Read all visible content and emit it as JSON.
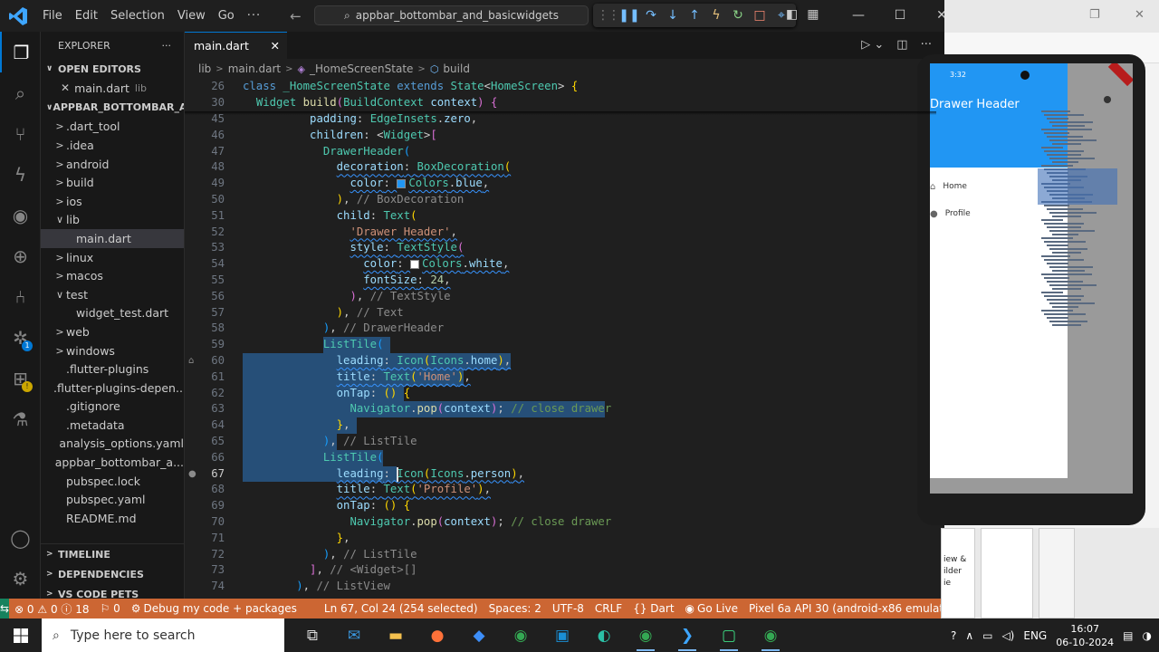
{
  "window": {
    "menu": [
      "File",
      "Edit",
      "Selection",
      "View",
      "Go",
      "···"
    ],
    "command_center": "appbar_bottombar_and_basicwidgets",
    "colors": {
      "accent": "#0078d4",
      "statusbar": "#cc6633",
      "remote": "#16825d",
      "selection": "#264f78"
    }
  },
  "sidebar": {
    "title": "EXPLORER",
    "open_editors_title": "OPEN EDITORS",
    "open_editor": {
      "name": "main.dart",
      "path": "lib"
    },
    "project_title": "APPBAR_BOTTOMBAR_AN...",
    "tree": [
      {
        "label": ".dart_tool",
        "folder": true,
        "open": false,
        "depth": 0
      },
      {
        "label": ".idea",
        "folder": true,
        "open": false,
        "depth": 0
      },
      {
        "label": "android",
        "folder": true,
        "open": false,
        "depth": 0
      },
      {
        "label": "build",
        "folder": true,
        "open": false,
        "depth": 0
      },
      {
        "label": "ios",
        "folder": true,
        "open": false,
        "depth": 0
      },
      {
        "label": "lib",
        "folder": true,
        "open": true,
        "depth": 0
      },
      {
        "label": "main.dart",
        "folder": false,
        "depth": 1,
        "selected": true
      },
      {
        "label": "linux",
        "folder": true,
        "open": false,
        "depth": 0
      },
      {
        "label": "macos",
        "folder": true,
        "open": false,
        "depth": 0
      },
      {
        "label": "test",
        "folder": true,
        "open": true,
        "depth": 0
      },
      {
        "label": "widget_test.dart",
        "folder": false,
        "depth": 1
      },
      {
        "label": "web",
        "folder": true,
        "open": false,
        "depth": 0
      },
      {
        "label": "windows",
        "folder": true,
        "open": false,
        "depth": 0
      },
      {
        "label": ".flutter-plugins",
        "folder": false,
        "depth": 0
      },
      {
        "label": ".flutter-plugins-depen...",
        "folder": false,
        "depth": 0
      },
      {
        "label": ".gitignore",
        "folder": false,
        "depth": 0
      },
      {
        "label": ".metadata",
        "folder": false,
        "depth": 0
      },
      {
        "label": "analysis_options.yaml",
        "folder": false,
        "depth": 0
      },
      {
        "label": "appbar_bottombar_a...",
        "folder": false,
        "depth": 0
      },
      {
        "label": "pubspec.lock",
        "folder": false,
        "depth": 0
      },
      {
        "label": "pubspec.yaml",
        "folder": false,
        "depth": 0
      },
      {
        "label": "README.md",
        "folder": false,
        "depth": 0
      }
    ],
    "bottom_sections": [
      "TIMELINE",
      "DEPENDENCIES",
      "VS CODE PETS"
    ]
  },
  "editor": {
    "tab": "main.dart",
    "breadcrumb": [
      "lib",
      "main.dart",
      "_HomeScreenState",
      "build"
    ],
    "sticky_lines": [
      {
        "num": "26",
        "tokens": [
          [
            "class ",
            "kw"
          ],
          [
            "_HomeScreenState ",
            "cls"
          ],
          [
            "extends ",
            "kw"
          ],
          [
            "State",
            "cls"
          ],
          [
            "<",
            ""
          ],
          [
            "HomeScreen",
            "cls"
          ],
          [
            "> ",
            ""
          ],
          [
            "{",
            "br1"
          ]
        ]
      },
      {
        "num": "30",
        "tokens": [
          [
            "  ",
            ""
          ],
          [
            "Widget ",
            "cls"
          ],
          [
            "build",
            "fn"
          ],
          [
            "(",
            "br2"
          ],
          [
            "BuildContext ",
            "cls"
          ],
          [
            "context",
            "prm"
          ],
          [
            ") ",
            "br2"
          ],
          [
            "{",
            "br2"
          ]
        ]
      }
    ],
    "lines": [
      {
        "num": "45",
        "tokens": [
          [
            "          ",
            ""
          ],
          [
            "padding",
            "prm"
          ],
          [
            ": ",
            ""
          ],
          [
            "EdgeInsets",
            "cls"
          ],
          [
            ".",
            ""
          ],
          [
            "zero",
            "prm"
          ],
          [
            ",",
            ""
          ]
        ]
      },
      {
        "num": "46",
        "tokens": [
          [
            "          ",
            ""
          ],
          [
            "children",
            "prm"
          ],
          [
            ": <",
            ""
          ],
          [
            "Widget",
            "cls"
          ],
          [
            ">",
            ""
          ],
          [
            "[",
            "br2"
          ]
        ]
      },
      {
        "num": "47",
        "tokens": [
          [
            "            ",
            ""
          ],
          [
            "DrawerHeader",
            "cls"
          ],
          [
            "(",
            "br3"
          ]
        ]
      },
      {
        "num": "48",
        "tokens": [
          [
            "              ",
            ""
          ],
          [
            "decoration",
            "prm"
          ],
          [
            ": ",
            ""
          ],
          [
            "BoxDecoration",
            "cls"
          ],
          [
            "(",
            "br1"
          ]
        ]
      },
      {
        "num": "49",
        "tokens": [
          [
            "                ",
            ""
          ],
          [
            "color",
            "prm"
          ],
          [
            ": ",
            ""
          ],
          [
            "■",
            "swatch-blue"
          ],
          [
            "Colors",
            "cls"
          ],
          [
            ".",
            ""
          ],
          [
            "blue",
            "prm"
          ],
          [
            ",",
            ""
          ]
        ]
      },
      {
        "num": "50",
        "tokens": [
          [
            "              ",
            ""
          ],
          [
            ")",
            "br1"
          ],
          [
            ", ",
            ""
          ],
          [
            "// BoxDecoration",
            "gray"
          ]
        ]
      },
      {
        "num": "51",
        "tokens": [
          [
            "              ",
            ""
          ],
          [
            "child",
            "prm"
          ],
          [
            ": ",
            ""
          ],
          [
            "Text",
            "cls"
          ],
          [
            "(",
            "br1"
          ]
        ]
      },
      {
        "num": "52",
        "tokens": [
          [
            "                ",
            ""
          ],
          [
            "'Drawer Header'",
            "str"
          ],
          [
            ",",
            ""
          ]
        ]
      },
      {
        "num": "53",
        "tokens": [
          [
            "                ",
            ""
          ],
          [
            "style",
            "prm"
          ],
          [
            ": ",
            ""
          ],
          [
            "TextStyle",
            "cls"
          ],
          [
            "(",
            "br2"
          ]
        ]
      },
      {
        "num": "54",
        "tokens": [
          [
            "                  ",
            ""
          ],
          [
            "color",
            "prm"
          ],
          [
            ": ",
            ""
          ],
          [
            "■",
            "swatch-white"
          ],
          [
            "Colors",
            "cls"
          ],
          [
            ".",
            ""
          ],
          [
            "white",
            "prm"
          ],
          [
            ",",
            ""
          ]
        ]
      },
      {
        "num": "55",
        "tokens": [
          [
            "                  ",
            ""
          ],
          [
            "fontSize",
            "prm"
          ],
          [
            ": ",
            ""
          ],
          [
            "24",
            "num"
          ],
          [
            ",",
            ""
          ]
        ]
      },
      {
        "num": "56",
        "tokens": [
          [
            "                ",
            ""
          ],
          [
            ")",
            "br2"
          ],
          [
            ", ",
            ""
          ],
          [
            "// TextStyle",
            "gray"
          ]
        ]
      },
      {
        "num": "57",
        "tokens": [
          [
            "              ",
            ""
          ],
          [
            ")",
            "br1"
          ],
          [
            ", ",
            ""
          ],
          [
            "// Text",
            "gray"
          ]
        ]
      },
      {
        "num": "58",
        "tokens": [
          [
            "            ",
            ""
          ],
          [
            ")",
            "br3"
          ],
          [
            ", ",
            ""
          ],
          [
            "// DrawerHeader",
            "gray"
          ]
        ]
      },
      {
        "num": "59",
        "tokens": [
          [
            "            ",
            ""
          ],
          [
            "ListTile",
            "cls"
          ],
          [
            "(",
            "br3"
          ]
        ]
      },
      {
        "num": "60",
        "tokens": [
          [
            "              ",
            ""
          ],
          [
            "leading",
            "prm"
          ],
          [
            ": ",
            ""
          ],
          [
            "Icon",
            "cls"
          ],
          [
            "(",
            "br1"
          ],
          [
            "Icons",
            "cls"
          ],
          [
            ".",
            ""
          ],
          [
            "home",
            "prm"
          ],
          [
            ")",
            "br1"
          ],
          [
            ",",
            ""
          ]
        ]
      },
      {
        "num": "61",
        "tokens": [
          [
            "              ",
            ""
          ],
          [
            "title",
            "prm"
          ],
          [
            ": ",
            ""
          ],
          [
            "Text",
            "cls"
          ],
          [
            "(",
            "br1"
          ],
          [
            "'Home'",
            "str"
          ],
          [
            ")",
            "br1"
          ],
          [
            ",",
            ""
          ]
        ]
      },
      {
        "num": "62",
        "tokens": [
          [
            "              ",
            ""
          ],
          [
            "onTap",
            "prm"
          ],
          [
            ": ",
            ""
          ],
          [
            "() ",
            "br1"
          ],
          [
            "{",
            "br1"
          ]
        ]
      },
      {
        "num": "63",
        "tokens": [
          [
            "                ",
            ""
          ],
          [
            "Navigator",
            "cls"
          ],
          [
            ".",
            ""
          ],
          [
            "pop",
            "fn"
          ],
          [
            "(",
            "br2"
          ],
          [
            "context",
            "prm"
          ],
          [
            ")",
            "br2"
          ],
          [
            "; ",
            ""
          ],
          [
            "// close drawer",
            "cmt"
          ]
        ]
      },
      {
        "num": "64",
        "tokens": [
          [
            "              ",
            ""
          ],
          [
            "}",
            "br1"
          ],
          [
            ",",
            ""
          ]
        ]
      },
      {
        "num": "65",
        "tokens": [
          [
            "            ",
            ""
          ],
          [
            ")",
            "br3"
          ],
          [
            ", ",
            ""
          ],
          [
            "// ListTile",
            "gray"
          ]
        ]
      },
      {
        "num": "66",
        "tokens": [
          [
            "            ",
            ""
          ],
          [
            "ListTile",
            "cls"
          ],
          [
            "(",
            "br3"
          ]
        ]
      },
      {
        "num": "67",
        "tokens": [
          [
            "              ",
            ""
          ],
          [
            "leading",
            "prm"
          ],
          [
            ": ",
            ""
          ],
          [
            "Icon",
            "cls"
          ],
          [
            "(",
            "br1"
          ],
          [
            "Icons",
            "cls"
          ],
          [
            ".",
            ""
          ],
          [
            "person",
            "prm"
          ],
          [
            ")",
            "br1"
          ],
          [
            ",",
            ""
          ]
        ]
      },
      {
        "num": "68",
        "tokens": [
          [
            "              ",
            ""
          ],
          [
            "title",
            "prm"
          ],
          [
            ": ",
            ""
          ],
          [
            "Text",
            "cls"
          ],
          [
            "(",
            "br1"
          ],
          [
            "'Profile'",
            "str"
          ],
          [
            ")",
            "br1"
          ],
          [
            ",",
            ""
          ]
        ]
      },
      {
        "num": "69",
        "tokens": [
          [
            "              ",
            ""
          ],
          [
            "onTap",
            "prm"
          ],
          [
            ": ",
            ""
          ],
          [
            "() ",
            "br1"
          ],
          [
            "{",
            "br1"
          ]
        ]
      },
      {
        "num": "70",
        "tokens": [
          [
            "                ",
            ""
          ],
          [
            "Navigator",
            "cls"
          ],
          [
            ".",
            ""
          ],
          [
            "pop",
            "fn"
          ],
          [
            "(",
            "br2"
          ],
          [
            "context",
            "prm"
          ],
          [
            ")",
            "br2"
          ],
          [
            "; ",
            ""
          ],
          [
            "// close drawer",
            "cmt"
          ]
        ]
      },
      {
        "num": "71",
        "tokens": [
          [
            "              ",
            ""
          ],
          [
            "}",
            "br1"
          ],
          [
            ",",
            ""
          ]
        ]
      },
      {
        "num": "72",
        "tokens": [
          [
            "            ",
            ""
          ],
          [
            ")",
            "br3"
          ],
          [
            ", ",
            ""
          ],
          [
            "// ListTile",
            "gray"
          ]
        ]
      },
      {
        "num": "73",
        "tokens": [
          [
            "          ",
            ""
          ],
          [
            "]",
            "br2"
          ],
          [
            ", ",
            ""
          ],
          [
            "// <Widget>[]",
            "gray"
          ]
        ]
      },
      {
        "num": "74",
        "tokens": [
          [
            "        ",
            ""
          ],
          [
            ")",
            "br3"
          ],
          [
            ", ",
            ""
          ],
          [
            "// ListView",
            "gray"
          ]
        ]
      }
    ],
    "current_line": "67"
  },
  "statusbar": {
    "problems": "⊗ 0 ⚠ 0 ⓘ 18",
    "ports": "⚐ 0",
    "debug": "Debug my code + packages",
    "cursor": "Ln 67, Col 24 (254 selected)",
    "spaces": "Spaces: 2",
    "encoding": "UTF-8",
    "eol": "CRLF",
    "language": "{} Dart",
    "live": "Go Live",
    "device": "Pixel 6a API 30 (android-x86 emulator)"
  },
  "emulator": {
    "time": "3:32",
    "drawer_title": "Drawer Header",
    "items": [
      "Home",
      "Profile"
    ],
    "thumb_text": [
      "iew &",
      "ilder",
      "ie"
    ]
  },
  "taskbar": {
    "search_placeholder": "Type here to search",
    "language": "ENG",
    "time": "16:07",
    "date": "06-10-2024"
  }
}
